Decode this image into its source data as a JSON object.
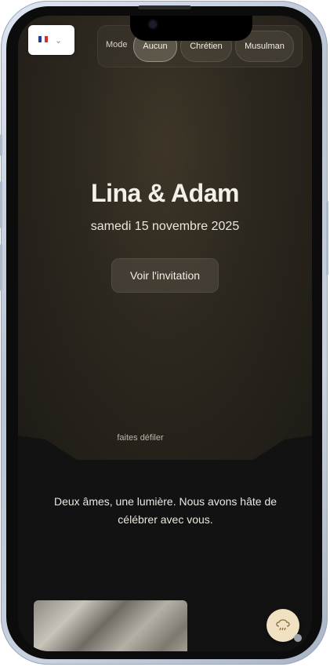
{
  "language": {
    "flag_colors": [
      "#1f3f9e",
      "#ffffff",
      "#d92b2b"
    ],
    "flag_icon": "french-flag-icon",
    "dropdown_icon": "chevron-down-icon"
  },
  "mode": {
    "label": "Mode",
    "options": [
      "Aucun",
      "Chrétien",
      "Musulman"
    ],
    "selected": "Aucun"
  },
  "hero": {
    "title": "Lina & Adam",
    "date": "samedi 15 novembre 2025",
    "invite_button": "Voir l'invitation",
    "scroll_hint": "faites défiler"
  },
  "intro": {
    "quote": "Deux âmes, une lumière. Nous avons hâte de célébrer avec vous."
  },
  "fab": {
    "icon": "music-cloud-icon"
  },
  "colors": {
    "accent": "#efe1c1",
    "background": "#121212",
    "hero": "#2c271e"
  }
}
